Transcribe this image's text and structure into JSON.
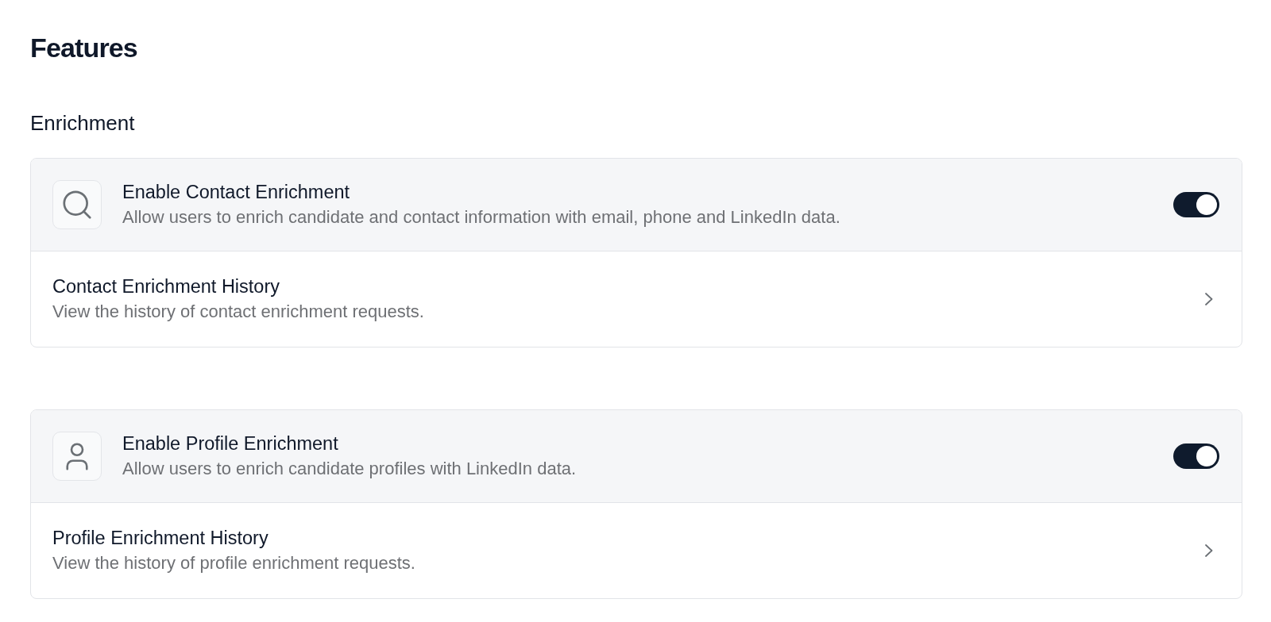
{
  "page": {
    "title": "Features"
  },
  "section": {
    "title": "Enrichment"
  },
  "cards": [
    {
      "kind": "contact",
      "title": "Enable Contact Enrichment",
      "description": "Allow users to enrich candidate and contact information with email, phone and LinkedIn data.",
      "on": true,
      "history": {
        "title": "Contact Enrichment History",
        "description": "View the history of contact enrichment requests."
      }
    },
    {
      "kind": "profile",
      "title": "Enable Profile Enrichment",
      "description": "Allow users to enrich candidate profiles with LinkedIn data.",
      "on": true,
      "history": {
        "title": "Profile Enrichment History",
        "description": "View the history of profile enrichment requests."
      }
    }
  ]
}
